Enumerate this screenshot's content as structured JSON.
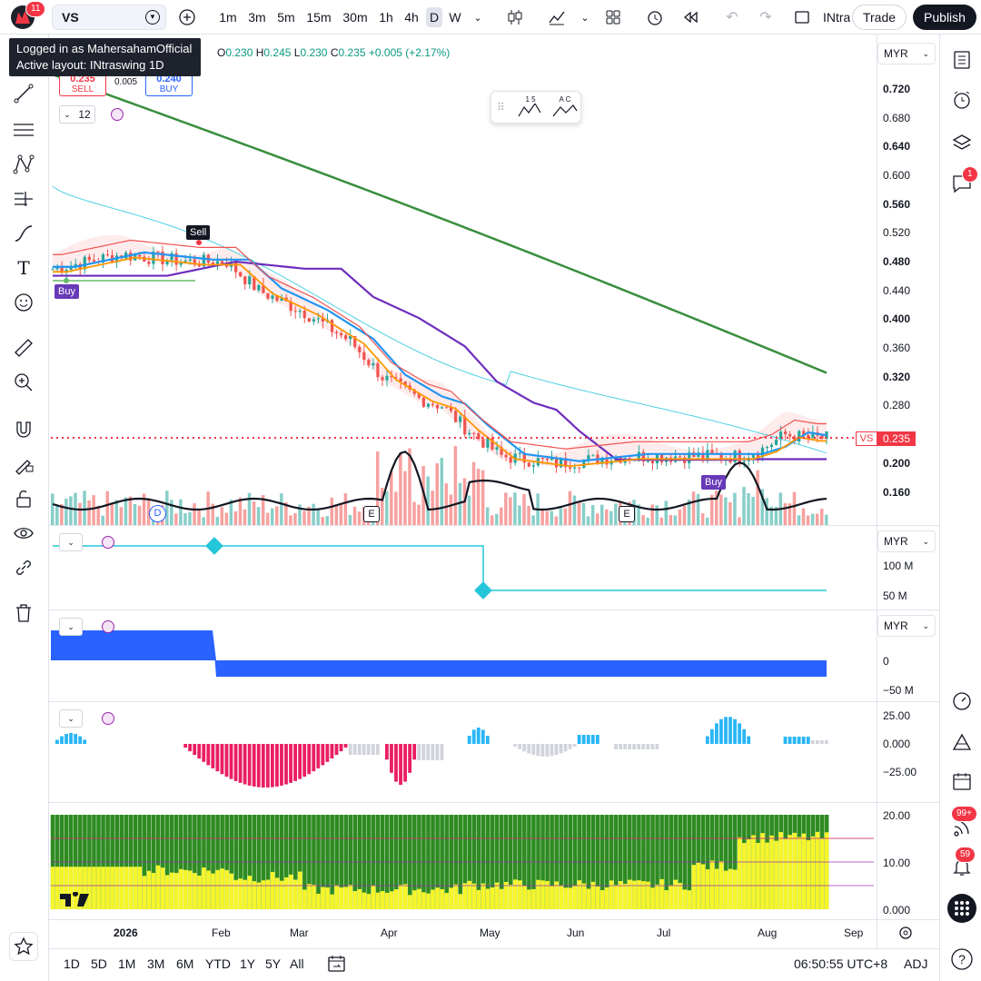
{
  "app": {
    "notification_count": "11"
  },
  "symbol": {
    "ticker": "VS"
  },
  "toolbar": {
    "intervals": [
      "1m",
      "3m",
      "5m",
      "15m",
      "30m",
      "1h",
      "4h",
      "D",
      "W"
    ],
    "active_interval": "D",
    "layout_name": "INtra",
    "trade_label": "Trade",
    "publish_label": "Publish"
  },
  "tooltip": {
    "line1": "Logged in as MahersahamOfficial",
    "line2": "Active layout: INtraswing 1D"
  },
  "ohlc": {
    "o_label": "O",
    "o": "0.230",
    "h_label": "H",
    "h": "0.245",
    "l_label": "L",
    "l": "0.230",
    "c_label": "C",
    "c": "0.235",
    "change": "+0.005 (+2.17%)"
  },
  "order": {
    "sell_price": "0.235",
    "sell_label": "SELL",
    "spread": "0.005",
    "buy_price": "0.240",
    "buy_label": "BUY"
  },
  "indicator_count": "12",
  "float_toolbar": {
    "wave1": "1 5",
    "wave2": "A C"
  },
  "signals": {
    "sell": "Sell",
    "buy": "Buy",
    "buy2": "Buy"
  },
  "events": {
    "dividend": "D",
    "earnings1": "E",
    "earnings2": "E"
  },
  "price_axis": {
    "currency": "MYR",
    "labels": [
      "0.720",
      "0.680",
      "0.640",
      "0.600",
      "0.560",
      "0.520",
      "0.480",
      "0.440",
      "0.400",
      "0.360",
      "0.320",
      "0.280",
      "0.200",
      "0.160"
    ],
    "bold": [
      "0.720",
      "0.640",
      "0.560",
      "0.480",
      "0.400",
      "0.320",
      "0.200",
      "0.160"
    ],
    "current_tag": "VS",
    "current_price": "0.235"
  },
  "pane2": {
    "currency": "MYR",
    "labels": [
      "100 M",
      "50 M"
    ]
  },
  "pane3": {
    "currency": "MYR",
    "labels": [
      "0",
      "−50 M"
    ]
  },
  "pane4": {
    "labels": [
      "25.00",
      "0.000",
      "−25.00"
    ]
  },
  "pane5": {
    "labels": [
      "20.00",
      "10.00",
      "0.000"
    ]
  },
  "time_axis": [
    "2026",
    "Feb",
    "Mar",
    "Apr",
    "May",
    "Jun",
    "Jul",
    "Aug",
    "Sep"
  ],
  "bottom": {
    "ranges": [
      "1D",
      "5D",
      "1M",
      "3M",
      "6M",
      "YTD",
      "1Y",
      "5Y",
      "All"
    ],
    "clock": "06:50:55 UTC+8",
    "adj": "ADJ"
  },
  "right_badges": {
    "chat": "1",
    "streams": "99+",
    "alerts": "59"
  },
  "colors": {
    "up": "#26a69a",
    "down": "#ef5350",
    "ema_green": "#388e3c",
    "ema_purple": "#6f2dbd",
    "ema_blue": "#2196f3",
    "ema_orange": "#ff9800",
    "accent": "#2962ff"
  },
  "chart_data": {
    "type": "candlestick",
    "symbol": "VS",
    "x_range": [
      "2025-12",
      "2026-09"
    ],
    "y_range": [
      0.14,
      0.74
    ],
    "close_approx": [
      0.47,
      0.49,
      0.5,
      0.48,
      0.49,
      0.48,
      0.48,
      0.49,
      0.47,
      0.47,
      0.48,
      0.46,
      0.45,
      0.43,
      0.42,
      0.41,
      0.4,
      0.39,
      0.38,
      0.37,
      0.34,
      0.32,
      0.3,
      0.29,
      0.28,
      0.27,
      0.27,
      0.24,
      0.22,
      0.21,
      0.2,
      0.2,
      0.21,
      0.21,
      0.22,
      0.22,
      0.21,
      0.21,
      0.21,
      0.21,
      0.21,
      0.21,
      0.21,
      0.21,
      0.22,
      0.23,
      0.24,
      0.23,
      0.23,
      0.235
    ],
    "last_close": 0.235
  }
}
